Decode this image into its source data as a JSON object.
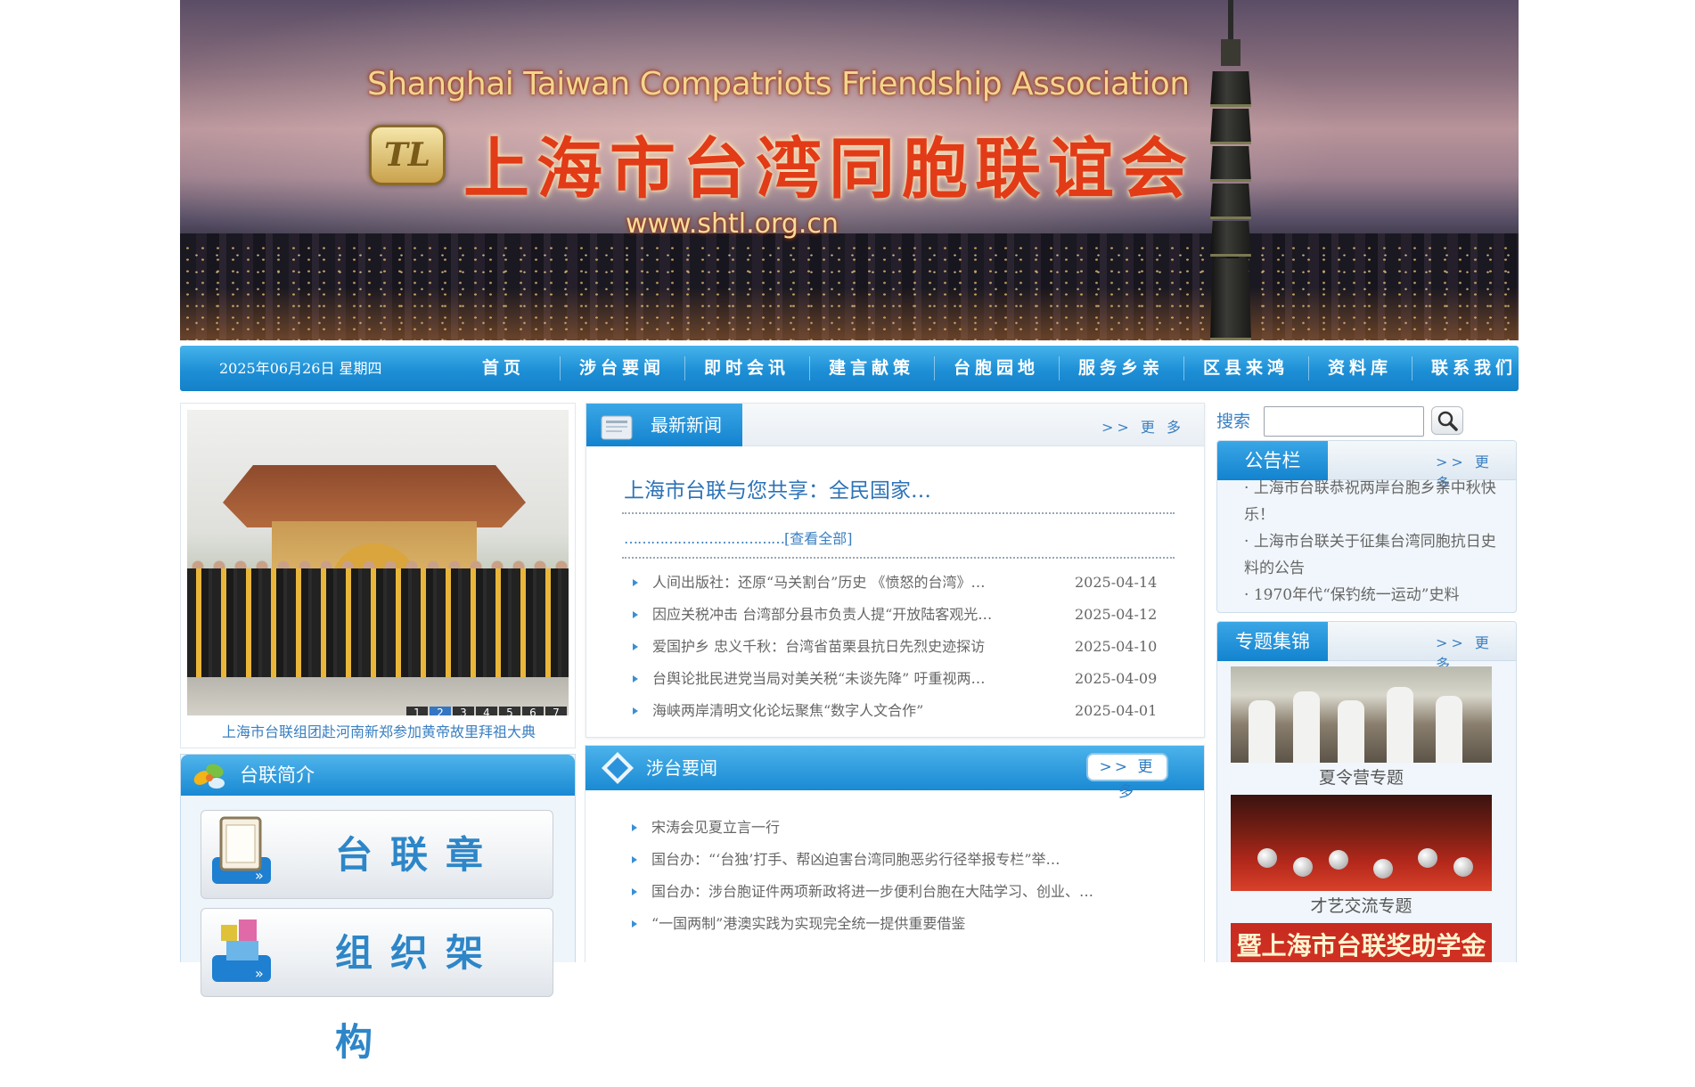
{
  "banner": {
    "title_en": "Shanghai Taiwan Compatriots  Friendship Association",
    "title_cn": "上海市台湾同胞联谊会",
    "url": "www.shtl.org.cn",
    "logo_text": "TL"
  },
  "nav": {
    "date": "2025年06月26日  星期四",
    "items": [
      "首页",
      "涉台要闻",
      "即时会讯",
      "建言献策",
      "台胞园地",
      "服务乡亲",
      "区县来鸿",
      "资料库",
      "联系我们"
    ]
  },
  "slider": {
    "pages": [
      "1",
      "2",
      "3",
      "4",
      "5",
      "6",
      "7"
    ],
    "active_page": "2",
    "caption": "上海市台联组团赴河南新郑参加黄帝故里拜祖大典"
  },
  "intro": {
    "title": "台联简介",
    "buttons": [
      "台联章程",
      "组织架构"
    ]
  },
  "latest_news": {
    "title": "最新新闻",
    "more": ">> 更 多",
    "headline": "上海市台联与您共享：全民国家…",
    "view_all_dots": "………………………………",
    "view_all": "[查看全部]",
    "items": [
      {
        "title": "人间出版社：还原“马关割台”历史 《愤怒的台湾》…",
        "date": "2025-04-14"
      },
      {
        "title": "因应关税冲击 台湾部分县市负责人提“开放陆客观光…",
        "date": "2025-04-12"
      },
      {
        "title": "爱国护乡 忠义千秋：台湾省苗栗县抗日先烈史迹探访",
        "date": "2025-04-10"
      },
      {
        "title": "台舆论批民进党当局对美关税“未谈先降” 吁重视两…",
        "date": "2025-04-09"
      },
      {
        "title": "海峡两岸清明文化论坛聚焦“数字人文合作”",
        "date": "2025-04-01"
      }
    ]
  },
  "taiwan_news": {
    "title": "涉台要闻",
    "more": ">> 更 多",
    "items": [
      "宋涛会见夏立言一行",
      "国台办：“‘台独’打手、帮凶迫害台湾同胞恶劣行径举报专栏”举…",
      "国台办：涉台胞证件两项新政将进一步便利台胞在大陆学习、创业、…",
      "“一国两制”港澳实践为实现完全统一提供重要借鉴"
    ]
  },
  "search": {
    "label": "搜索",
    "value": "",
    "placeholder": ""
  },
  "notice": {
    "title": "公告栏",
    "more": ">> 更 多",
    "items": [
      "上海市台联恭祝两岸台胞乡亲中秋快乐！",
      "上海市台联关于征集台湾同胞抗日史料的公告",
      "1970年代“保钓统一运动”史料"
    ]
  },
  "topics": {
    "title": "专题集锦",
    "more": ">> 更 多",
    "items": [
      {
        "caption": "夏令营专题"
      },
      {
        "caption": "才艺交流专题"
      },
      {
        "caption": "暨上海市台联奖助学金颁发"
      }
    ]
  },
  "colors": {
    "nav_blue": "#1d8fd6",
    "link_blue": "#3a7fc1",
    "title_red": "#e23b17"
  }
}
